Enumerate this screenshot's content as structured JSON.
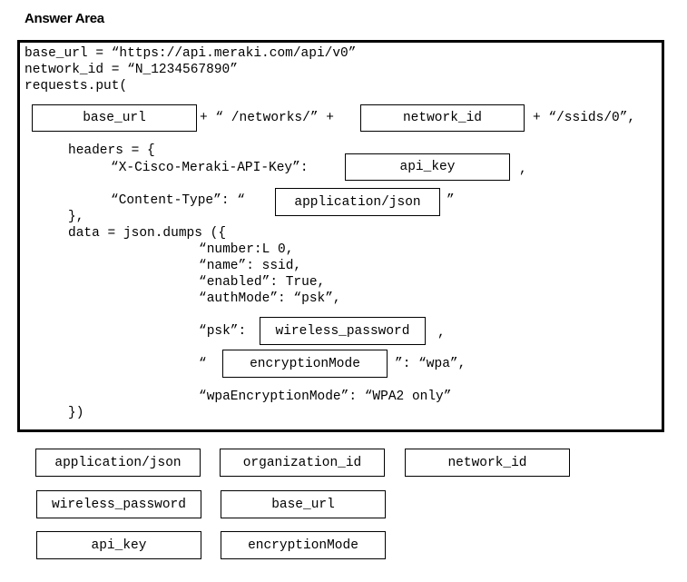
{
  "title": "Answer Area",
  "code": {
    "line_base_url": "base_url = “https://api.meraki.com/api/v0”",
    "line_network_id": "network_id = “N_1234567890”",
    "line_requests": "requests.put(",
    "url_part1": "+ “ /networks/” +",
    "url_part2": "+ “/ssids/0”,",
    "headers_open": "headers = {",
    "api_key_label": "“X-Cisco-Meraki-API-Key”:",
    "api_key_comma": ",",
    "content_type_label": "“Content-Type”: “",
    "content_type_close": "”",
    "headers_close": "},",
    "data_open": "data = json.dumps ({",
    "number_line": "“number:L 0,",
    "name_line": "“name”: ssid,",
    "enabled_line": "“enabled”: True,",
    "authmode_line": "“authMode”: “psk”,",
    "psk_label": "“psk”:",
    "psk_comma": ",",
    "enc_open_quote": "“",
    "enc_suffix": "”: “wpa”,",
    "wpa_enc_line": "“wpaEncryptionMode”: “WPA2 only”",
    "data_close": "})"
  },
  "slots": {
    "url_base": "base_url",
    "url_network": "network_id",
    "api_key": "api_key",
    "content_type": "application/json",
    "psk": "wireless_password",
    "enc_key": "encryptionMode"
  },
  "options": [
    "application/json",
    "organization_id",
    "network_id",
    "wireless_password",
    "base_url",
    "api_key",
    "encryptionMode"
  ]
}
